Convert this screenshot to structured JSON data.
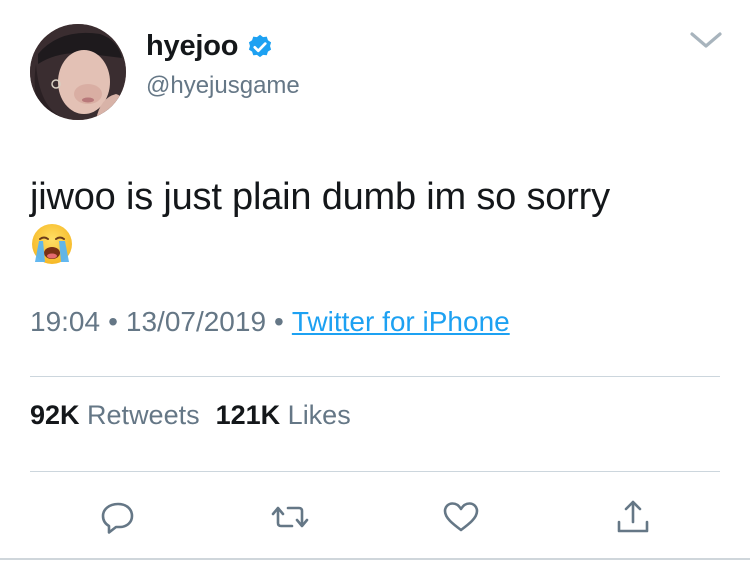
{
  "user": {
    "display_name": "hyejoo",
    "username": "@hyejusgame",
    "verified": true
  },
  "tweet": {
    "text": "jiwoo is just plain dumb im so sorry",
    "emoji": "loudly-crying-face"
  },
  "meta": {
    "time": "19:04",
    "separator": "•",
    "date": "13/07/2019",
    "source": "Twitter for iPhone"
  },
  "stats": {
    "retweets_count": "92K",
    "retweets_label": "Retweets",
    "likes_count": "121K",
    "likes_label": "Likes"
  },
  "icons": {
    "reply": "reply-icon",
    "retweet": "retweet-icon",
    "like": "heart-icon",
    "share": "share-icon"
  },
  "colors": {
    "accent": "#1da1f2",
    "secondary_text": "#657786",
    "primary_text": "#14171a",
    "divider": "#ccd6dd"
  }
}
